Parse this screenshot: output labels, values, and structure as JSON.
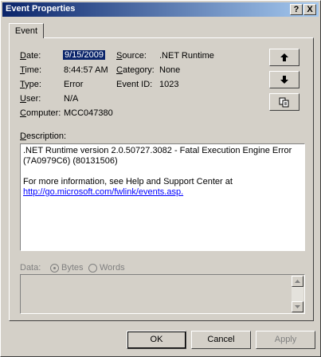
{
  "window": {
    "title": "Event Properties",
    "help_label": "?",
    "close_label": "X"
  },
  "tabs": [
    {
      "label": "Event"
    }
  ],
  "fields": {
    "date_label": "Date:",
    "date_value": "9/15/2009",
    "time_label": "Time:",
    "time_value": "8:44:57 AM",
    "type_label": "Type:",
    "type_value": "Error",
    "user_label": "User:",
    "user_value": "N/A",
    "computer_label": "Computer:",
    "computer_value": "MCC047380",
    "source_label": "Source:",
    "source_value": ".NET Runtime",
    "category_label": "Category:",
    "category_value": "None",
    "eventid_label": "Event ID:",
    "eventid_value": "1023"
  },
  "description": {
    "label": "Description:",
    "line1": ".NET Runtime version 2.0.50727.3082 - Fatal Execution Engine Error (7A0979C6) (80131506)",
    "line2": "For more information, see Help and Support Center at",
    "link": "http://go.microsoft.com/fwlink/events.asp."
  },
  "data": {
    "label": "Data:",
    "bytes_label": "Bytes",
    "words_label": "Words",
    "selected": "Bytes"
  },
  "buttons": {
    "ok": "OK",
    "cancel": "Cancel",
    "apply": "Apply"
  },
  "icons": {
    "up": "arrow-up-icon",
    "down": "arrow-down-icon",
    "copy": "copy-icon"
  }
}
